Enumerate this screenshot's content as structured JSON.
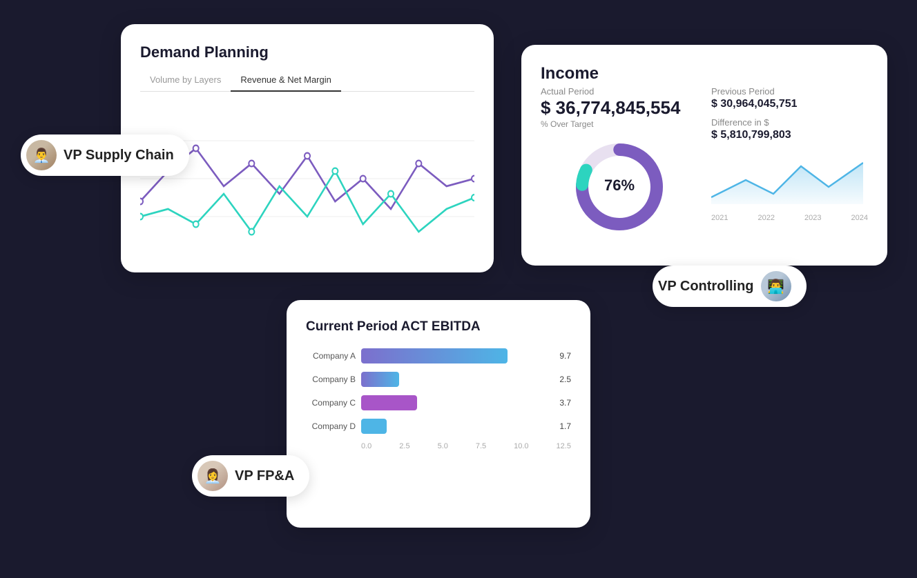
{
  "demand_card": {
    "title": "Demand Planning",
    "tabs": [
      {
        "label": "Volume by Layers",
        "active": false
      },
      {
        "label": "Revenue & Net Margin",
        "active": true
      }
    ]
  },
  "income_card": {
    "title": "Income",
    "actual_period_label": "Actual Period",
    "actual_period_value": "$ 36,774,845,554",
    "over_target_label": "% Over Target",
    "donut_value": "76%",
    "previous_period_label": "Previous Period",
    "previous_period_value": "$ 30,964,045,751",
    "difference_label": "Difference in $",
    "difference_value": "$ 5,810,799,803",
    "sparkline_years": [
      "2021",
      "2022",
      "2023",
      "2024"
    ]
  },
  "ebitda_card": {
    "title": "Current Period ACT EBITDA",
    "companies": [
      {
        "name": "Company A",
        "value": 9.7
      },
      {
        "name": "Company B",
        "value": 2.5
      },
      {
        "name": "Company C",
        "value": 3.7
      },
      {
        "name": "Company D",
        "value": 1.7
      }
    ],
    "axis_labels": [
      "0.0",
      "2.5",
      "5.0",
      "7.5",
      "10.0",
      "12.5"
    ],
    "max_value": 12.5
  },
  "vp_supply": {
    "label": "VP Supply Chain",
    "emoji": "👨‍💼"
  },
  "vp_controlling": {
    "label": "VP Controlling",
    "emoji": "👨‍💻"
  },
  "vp_fpa": {
    "label": "VP FP&A",
    "emoji": "👩‍💼"
  },
  "bar_colors": {
    "company_a": "linear-gradient(90deg, #7c6fcd, #4eb5e6)",
    "company_b": "linear-gradient(90deg, #7c6fcd, #4eb5e6)",
    "company_c": "#a855c8",
    "company_d": "#4eb5e6"
  }
}
